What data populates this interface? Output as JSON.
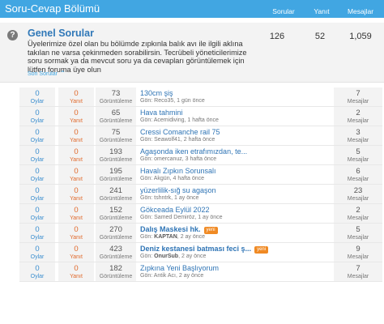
{
  "header": {
    "title": "Soru-Cevap Bölümü",
    "col_questions": "Sorular",
    "col_replies": "Yanıt",
    "col_posts": "Mesajlar",
    "bg_color": "#41a6e2"
  },
  "forum": {
    "icon": "question-circle-icon",
    "title": "Genel Sorular",
    "description": "Üyelerimize özel olan bu bölümde zıpkınla balık avı ile ilgili aklına takılan ne varsa çekinmeden sorabilirsin. Tecrübeli yöneticilerimize soru sormak ya da mevcut soru ya da cevapları görüntülemek için lütfen foruma üye olun",
    "questions": "126",
    "replies": "52",
    "posts": "1,059",
    "sub_label": "Son Sorular"
  },
  "labels": {
    "votes": "Oylar",
    "replies": "Yanıt",
    "views": "Görüntüleme",
    "posts": "Mesajlar",
    "started_by": "Gön:",
    "new_badge": "yeni"
  },
  "threads": [
    {
      "votes": "0",
      "replies": "0",
      "views": "73",
      "title": "130cm şiş",
      "author": "Reco35",
      "time": "1 gün önce",
      "posts": "7",
      "bold": false,
      "is_new": false
    },
    {
      "votes": "0",
      "replies": "0",
      "views": "65",
      "title": "Hava tahmini",
      "author": "Acemidiving",
      "time": "1 hafta önce",
      "posts": "2",
      "bold": false,
      "is_new": false
    },
    {
      "votes": "0",
      "replies": "0",
      "views": "75",
      "title": "Cressi Comanche rail 75",
      "author": "Seawolf41",
      "time": "2 hafta önce",
      "posts": "3",
      "bold": false,
      "is_new": false
    },
    {
      "votes": "0",
      "replies": "0",
      "views": "193",
      "title": "Agaşonda iken etrafımızdan, te...",
      "author": "omercanuz",
      "time": "3 hafta önce",
      "posts": "5",
      "bold": false,
      "is_new": false
    },
    {
      "votes": "0",
      "replies": "0",
      "views": "195",
      "title": "Havalı Zıpkın Sorunsalı",
      "author": "Akgün",
      "time": "4 hafta önce",
      "posts": "6",
      "bold": false,
      "is_new": false
    },
    {
      "votes": "0",
      "replies": "0",
      "views": "241",
      "title": "yüzerlilik-sığ su agaşon",
      "author": "tshntrk",
      "time": "1 ay önce",
      "posts": "23",
      "bold": false,
      "is_new": false
    },
    {
      "votes": "0",
      "replies": "0",
      "views": "152",
      "title": "Gökceada Eylül 2022",
      "author": "Samed Demiröz",
      "time": "1 ay önce",
      "posts": "2",
      "bold": false,
      "is_new": false
    },
    {
      "votes": "0",
      "replies": "0",
      "views": "270",
      "title": "Dalış Maskesi hk.",
      "author": "KAPTAN",
      "time": "2 ay önce",
      "posts": "5",
      "bold": true,
      "is_new": true
    },
    {
      "votes": "0",
      "replies": "0",
      "views": "423",
      "title": "Deniz kestanesi batması feci ş...",
      "author": "OnurSub",
      "time": "2 ay önce",
      "posts": "9",
      "bold": true,
      "is_new": true
    },
    {
      "votes": "0",
      "replies": "0",
      "views": "182",
      "title": "Zıpkına Yeni Başlıyorum",
      "author": "Antik Acı",
      "time": "2 ay önce",
      "posts": "7",
      "bold": false,
      "is_new": false
    }
  ]
}
